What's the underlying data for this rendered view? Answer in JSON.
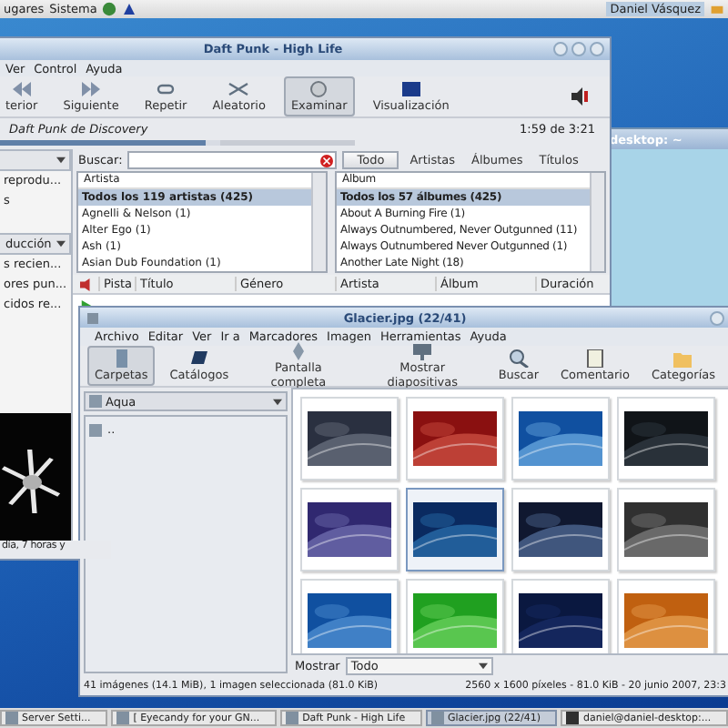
{
  "top_panel": {
    "menus": [
      "ugares",
      "Sistema"
    ],
    "user": "Daniel Vásquez"
  },
  "terminal": {
    "title": "desktop: ~"
  },
  "player": {
    "title": "Daft Punk - High Life",
    "menus": [
      "Ver",
      "Control",
      "Ayuda"
    ],
    "toolbar": [
      {
        "label": "terior",
        "kind": "prev",
        "selected": false
      },
      {
        "label": "Siguiente",
        "kind": "next",
        "selected": false
      },
      {
        "label": "Repetir",
        "kind": "repeat",
        "selected": false
      },
      {
        "label": "Aleatorio",
        "kind": "shuffle",
        "selected": false
      },
      {
        "label": "Examinar",
        "kind": "browse",
        "selected": true
      },
      {
        "label": "Visualización",
        "kind": "visual",
        "selected": false
      }
    ],
    "now_playing": "Daft Punk de Discovery",
    "time": "1:59 de 3:21",
    "position": {
      "level": 0.59
    },
    "sidebar": {
      "top_items": [
        "reprodu...",
        "s"
      ],
      "selector": "ducción",
      "items": [
        "s recien...",
        "ores pun...",
        "cidos re..."
      ],
      "status": "día, 7 horas y"
    },
    "search": {
      "label": "Buscar:",
      "filters": [
        {
          "label": "Todo",
          "selected": true
        },
        {
          "label": "Artistas",
          "selected": false
        },
        {
          "label": "Álbumes",
          "selected": false
        },
        {
          "label": "Títulos",
          "selected": false
        }
      ]
    },
    "artists": {
      "header": "Artista",
      "rows": [
        {
          "text": "Todos los 119 artistas (425)",
          "selected": true
        },
        {
          "text": "Agnelli & Nelson (1)",
          "selected": false
        },
        {
          "text": "Alter Ego (1)",
          "selected": false
        },
        {
          "text": "Ash (1)",
          "selected": false
        },
        {
          "text": "Asian Dub Foundation (1)",
          "selected": false
        }
      ]
    },
    "albums": {
      "header": "Álbum",
      "rows": [
        {
          "text": "Todos los 57 álbumes (425)",
          "selected": true
        },
        {
          "text": "About A Burning Fire (1)",
          "selected": false
        },
        {
          "text": "Always Outnumbered, Never Outgunned (11)",
          "selected": false
        },
        {
          "text": "Always Outnumbered Never Outgunned (1)",
          "selected": false
        },
        {
          "text": "Another Late Night (18)",
          "selected": false
        }
      ]
    },
    "track_columns": [
      "Pista",
      "Título",
      "Género",
      "Artista",
      "Álbum",
      "Duración"
    ]
  },
  "viewer": {
    "title": "Glacier.jpg (22/41)",
    "menus": [
      "Archivo",
      "Editar",
      "Ver",
      "Ir a",
      "Marcadores",
      "Imagen",
      "Herramientas",
      "Ayuda"
    ],
    "toolbar": [
      {
        "label": "Carpetas",
        "kind": "folders",
        "selected": true
      },
      {
        "label": "Catálogos",
        "kind": "catalogs",
        "selected": false
      },
      {
        "label": "Pantalla completa",
        "kind": "fullscreen",
        "selected": false
      },
      {
        "label": "Mostrar diapositivas",
        "kind": "slideshow",
        "selected": false
      },
      {
        "label": "Buscar",
        "kind": "search",
        "selected": false
      },
      {
        "label": "Comentario",
        "kind": "comment",
        "selected": false
      },
      {
        "label": "Categorías",
        "kind": "categories",
        "selected": false
      }
    ],
    "folder": "Aqua",
    "entries": [
      ".."
    ],
    "thumbnails": [
      {
        "kind": "picture",
        "selected": false
      },
      {
        "kind": "picture",
        "selected": false
      },
      {
        "kind": "picture",
        "selected": false
      },
      {
        "kind": "picture",
        "selected": false
      },
      {
        "kind": "picture",
        "selected": false
      },
      {
        "kind": "picture",
        "selected": true
      },
      {
        "kind": "picture",
        "selected": false
      },
      {
        "kind": "picture",
        "selected": false
      },
      {
        "kind": "picture",
        "selected": false
      },
      {
        "kind": "picture",
        "selected": false
      },
      {
        "kind": "picture",
        "selected": false
      },
      {
        "kind": "picture",
        "selected": false
      }
    ],
    "show_label": "Mostrar",
    "show_value": "Todo",
    "status_left": "41 imágenes (14.1 MiB), 1 imagen seleccionada (81.0 KiB)",
    "status_right": "2560 x 1600 píxeles - 81.0 KiB - 20 junio 2007, 23:3"
  },
  "taskbar": [
    {
      "label": "Server Setti...",
      "selected": false
    },
    {
      "label": "[ Eyecandy for your GN...",
      "selected": false
    },
    {
      "label": "Daft Punk - High Life",
      "selected": false
    },
    {
      "label": "Glacier.jpg (22/41)",
      "selected": true
    },
    {
      "label": "daniel@daniel-desktop:...",
      "selected": false
    }
  ]
}
